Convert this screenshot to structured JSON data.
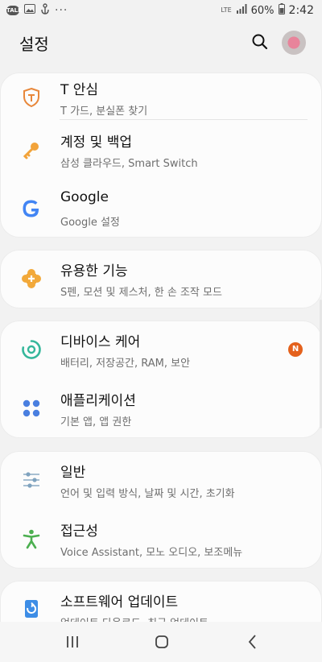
{
  "status_bar": {
    "talk_icon_text": "TALK",
    "dots": "···",
    "network": "LTE",
    "battery": "60%",
    "time": "2:42"
  },
  "header": {
    "title": "설정"
  },
  "items": [
    {
      "label": "T 안심",
      "sub": "T 가드, 분실폰 찾기",
      "icon": "t-shield-icon",
      "color": "#e8873a"
    },
    {
      "label": "계정 및 백업",
      "sub": "삼성 클라우드, Smart Switch",
      "icon": "key-icon",
      "color": "#f2a33a"
    },
    {
      "label": "Google",
      "sub": "Google 설정",
      "icon": "google-icon",
      "color": "#4285f4"
    },
    {
      "label": "유용한 기능",
      "sub": "S펜, 모션 및 제스처, 한 손 조작 모드",
      "icon": "puzzle-plus-icon",
      "color": "#f2a93a"
    },
    {
      "label": "디바이스 케어",
      "sub": "배터리, 저장공간, RAM, 보안",
      "icon": "device-care-icon",
      "color": "#35b79b",
      "badge": "N"
    },
    {
      "label": "애플리케이션",
      "sub": "기본 앱, 앱 권한",
      "icon": "apps-grid-icon",
      "color": "#4a7fe0"
    },
    {
      "label": "일반",
      "sub": "언어 및 입력 방식, 날짜 및 시간, 초기화",
      "icon": "sliders-icon",
      "color": "#7fa3bf"
    },
    {
      "label": "접근성",
      "sub": "Voice Assistant, 모노 오디오, 보조메뉴",
      "icon": "accessibility-icon",
      "color": "#4caf50"
    },
    {
      "label": "소프트웨어 업데이트",
      "sub": "업데이트 다운로드, 최근 업데이트",
      "icon": "software-update-icon",
      "color": "#3d8de6"
    }
  ],
  "colors": {
    "background": "#f2f2f2",
    "card": "#fcfcfc",
    "badge": "#e4611c"
  }
}
